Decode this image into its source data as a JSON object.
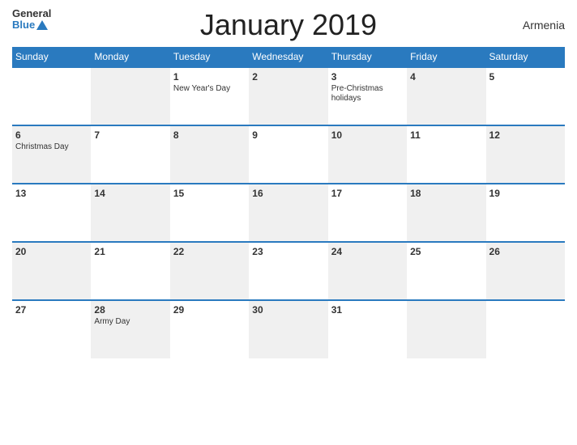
{
  "header": {
    "title": "January 2019",
    "country": "Armenia",
    "logo_general": "General",
    "logo_blue": "Blue"
  },
  "weekdays": [
    "Sunday",
    "Monday",
    "Tuesday",
    "Wednesday",
    "Thursday",
    "Friday",
    "Saturday"
  ],
  "weeks": [
    [
      {
        "day": "",
        "event": "",
        "gray": false
      },
      {
        "day": "",
        "event": "",
        "gray": true
      },
      {
        "day": "1",
        "event": "New Year's Day",
        "gray": false
      },
      {
        "day": "2",
        "event": "",
        "gray": true
      },
      {
        "day": "3",
        "event": "Pre-Christmas holidays",
        "gray": false
      },
      {
        "day": "4",
        "event": "",
        "gray": true
      },
      {
        "day": "5",
        "event": "",
        "gray": false
      }
    ],
    [
      {
        "day": "6",
        "event": "Christmas Day",
        "gray": true
      },
      {
        "day": "7",
        "event": "",
        "gray": false
      },
      {
        "day": "8",
        "event": "",
        "gray": true
      },
      {
        "day": "9",
        "event": "",
        "gray": false
      },
      {
        "day": "10",
        "event": "",
        "gray": true
      },
      {
        "day": "11",
        "event": "",
        "gray": false
      },
      {
        "day": "12",
        "event": "",
        "gray": true
      }
    ],
    [
      {
        "day": "13",
        "event": "",
        "gray": false
      },
      {
        "day": "14",
        "event": "",
        "gray": true
      },
      {
        "day": "15",
        "event": "",
        "gray": false
      },
      {
        "day": "16",
        "event": "",
        "gray": true
      },
      {
        "day": "17",
        "event": "",
        "gray": false
      },
      {
        "day": "18",
        "event": "",
        "gray": true
      },
      {
        "day": "19",
        "event": "",
        "gray": false
      }
    ],
    [
      {
        "day": "20",
        "event": "",
        "gray": true
      },
      {
        "day": "21",
        "event": "",
        "gray": false
      },
      {
        "day": "22",
        "event": "",
        "gray": true
      },
      {
        "day": "23",
        "event": "",
        "gray": false
      },
      {
        "day": "24",
        "event": "",
        "gray": true
      },
      {
        "day": "25",
        "event": "",
        "gray": false
      },
      {
        "day": "26",
        "event": "",
        "gray": true
      }
    ],
    [
      {
        "day": "27",
        "event": "",
        "gray": false
      },
      {
        "day": "28",
        "event": "Army Day",
        "gray": true
      },
      {
        "day": "29",
        "event": "",
        "gray": false
      },
      {
        "day": "30",
        "event": "",
        "gray": true
      },
      {
        "day": "31",
        "event": "",
        "gray": false
      },
      {
        "day": "",
        "event": "",
        "gray": true
      },
      {
        "day": "",
        "event": "",
        "gray": false
      }
    ]
  ]
}
